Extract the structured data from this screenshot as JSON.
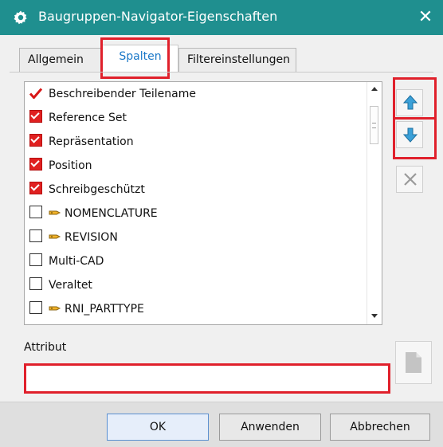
{
  "window": {
    "title": "Baugruppen-Navigator-Eigenschaften",
    "close_label": "✕"
  },
  "tabs": [
    {
      "label": "Allgemein",
      "active": false
    },
    {
      "label": "Spalten",
      "active": true
    },
    {
      "label": "Filtereinstellungen",
      "active": false
    }
  ],
  "columns_list": {
    "items": [
      {
        "label": "Beschreibender Teilename",
        "state": "tick"
      },
      {
        "label": "Reference Set",
        "state": "checked"
      },
      {
        "label": "Repräsentation",
        "state": "checked"
      },
      {
        "label": "Position",
        "state": "checked"
      },
      {
        "label": "Schreibgeschützt",
        "state": "checked"
      },
      {
        "label": "NOMENCLATURE",
        "state": "unchecked",
        "icon": "attribute-icon"
      },
      {
        "label": "REVISION",
        "state": "unchecked",
        "icon": "attribute-icon"
      },
      {
        "label": "Multi-CAD",
        "state": "unchecked"
      },
      {
        "label": "Veraltet",
        "state": "unchecked"
      },
      {
        "label": "RNI_PARTTYPE",
        "state": "unchecked",
        "icon": "attribute-icon"
      }
    ]
  },
  "side_buttons": {
    "move_up_icon": "arrow-up-icon",
    "move_down_icon": "arrow-down-icon",
    "delete_icon": "delete-x-icon"
  },
  "attribute": {
    "label": "Attribut",
    "value": ""
  },
  "footer": {
    "ok_label": "OK",
    "apply_label": "Anwenden",
    "cancel_label": "Abbrechen"
  },
  "colors": {
    "titlebar": "#1f8f8f",
    "highlight": "#e0202b",
    "active_tab_text": "#1b78c8",
    "arrow": "#3aa0d8"
  }
}
